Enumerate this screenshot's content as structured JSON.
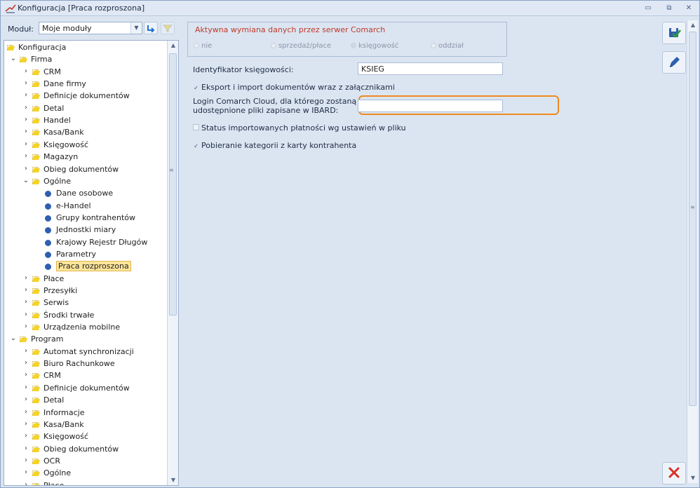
{
  "window": {
    "title": "Konfiguracja [Praca rozproszona]",
    "controls": [
      "minimize",
      "restore",
      "close"
    ]
  },
  "toolbar": {
    "modul_label": "Moduł:",
    "modul_value": "Moje moduły"
  },
  "tree": {
    "items": [
      {
        "label": "Konfiguracja",
        "level": 0,
        "type": "folder",
        "expander": ""
      },
      {
        "label": "Firma",
        "level": 1,
        "type": "folder",
        "expander": "down"
      },
      {
        "label": "CRM",
        "level": 2,
        "type": "folder",
        "expander": "right"
      },
      {
        "label": "Dane firmy",
        "level": 2,
        "type": "folder",
        "expander": "right"
      },
      {
        "label": "Definicje dokumentów",
        "level": 2,
        "type": "folder",
        "expander": "right"
      },
      {
        "label": "Detal",
        "level": 2,
        "type": "folder",
        "expander": "right"
      },
      {
        "label": "Handel",
        "level": 2,
        "type": "folder",
        "expander": "right"
      },
      {
        "label": "Kasa/Bank",
        "level": 2,
        "type": "folder",
        "expander": "right"
      },
      {
        "label": "Księgowość",
        "level": 2,
        "type": "folder",
        "expander": "right"
      },
      {
        "label": "Magazyn",
        "level": 2,
        "type": "folder",
        "expander": "right"
      },
      {
        "label": "Obieg dokumentów",
        "level": 2,
        "type": "folder",
        "expander": "right"
      },
      {
        "label": "Ogólne",
        "level": 2,
        "type": "folder",
        "expander": "down"
      },
      {
        "label": "Dane osobowe",
        "level": 3,
        "type": "leaf",
        "expander": ""
      },
      {
        "label": "e-Handel",
        "level": 3,
        "type": "leaf",
        "expander": ""
      },
      {
        "label": "Grupy kontrahentów",
        "level": 3,
        "type": "leaf",
        "expander": ""
      },
      {
        "label": "Jednostki miary",
        "level": 3,
        "type": "leaf",
        "expander": ""
      },
      {
        "label": "Krajowy Rejestr Długów",
        "level": 3,
        "type": "leaf",
        "expander": ""
      },
      {
        "label": "Parametry",
        "level": 3,
        "type": "leaf",
        "expander": ""
      },
      {
        "label": "Praca rozproszona",
        "level": 3,
        "type": "leaf",
        "expander": "",
        "selected": true
      },
      {
        "label": "Płace",
        "level": 2,
        "type": "folder",
        "expander": "right"
      },
      {
        "label": "Przesyłki",
        "level": 2,
        "type": "folder",
        "expander": "right"
      },
      {
        "label": "Serwis",
        "level": 2,
        "type": "folder",
        "expander": "right"
      },
      {
        "label": "Środki trwałe",
        "level": 2,
        "type": "folder",
        "expander": "right"
      },
      {
        "label": "Urządzenia mobilne",
        "level": 2,
        "type": "folder",
        "expander": "right"
      },
      {
        "label": "Program",
        "level": 1,
        "type": "folder",
        "expander": "down"
      },
      {
        "label": "Automat synchronizacji",
        "level": 2,
        "type": "folder",
        "expander": "right"
      },
      {
        "label": "Biuro Rachunkowe",
        "level": 2,
        "type": "folder",
        "expander": "right"
      },
      {
        "label": "CRM",
        "level": 2,
        "type": "folder",
        "expander": "right"
      },
      {
        "label": "Definicje dokumentów",
        "level": 2,
        "type": "folder",
        "expander": "right"
      },
      {
        "label": "Detal",
        "level": 2,
        "type": "folder",
        "expander": "right"
      },
      {
        "label": "Informacje",
        "level": 2,
        "type": "folder",
        "expander": "right"
      },
      {
        "label": "Kasa/Bank",
        "level": 2,
        "type": "folder",
        "expander": "right"
      },
      {
        "label": "Księgowość",
        "level": 2,
        "type": "folder",
        "expander": "right"
      },
      {
        "label": "Obieg dokumentów",
        "level": 2,
        "type": "folder",
        "expander": "right"
      },
      {
        "label": "OCR",
        "level": 2,
        "type": "folder",
        "expander": "right"
      },
      {
        "label": "Ogólne",
        "level": 2,
        "type": "folder",
        "expander": "right"
      },
      {
        "label": "Płace",
        "level": 2,
        "type": "folder",
        "expander": "right"
      }
    ]
  },
  "main": {
    "group_title": "Aktywna wymiana danych przez serwer Comarch",
    "radios": [
      {
        "label": "nie",
        "checked": false
      },
      {
        "label": "sprzedaż/płace",
        "checked": false
      },
      {
        "label": "księgowość",
        "checked": true
      },
      {
        "label": "oddział",
        "checked": false
      }
    ],
    "id_label": "Identyfikator księgowości:",
    "id_value": "KSIEG",
    "export_label": "Eksport i import dokumentów wraz z załącznikami",
    "export_checked": true,
    "login_label_line1": "Login Comarch Cloud, dla którego zostaną",
    "login_label_line2": "udostępnione pliki zapisane w IBARD:",
    "login_value": "",
    "status_label": "Status importowanych płatności wg ustawień w pliku",
    "status_checked": false,
    "pobieranie_label": "Pobieranie kategorii z karty kontrahenta",
    "pobieranie_checked": true
  },
  "icons": {
    "save": "save-icon",
    "edit": "edit-icon",
    "cancel": "cancel-icon",
    "close_color": "#d93025",
    "folder_color": "#f5d327",
    "highlight_color": "#f08a1d"
  }
}
